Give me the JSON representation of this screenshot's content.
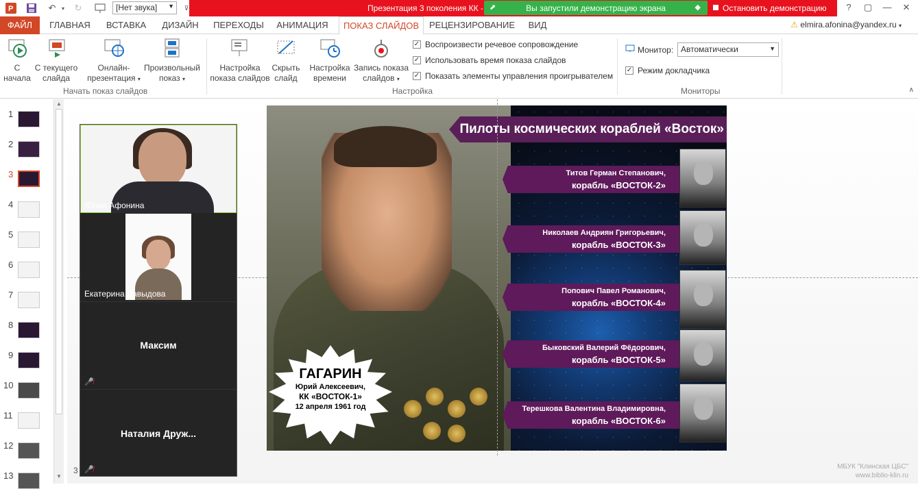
{
  "titlebar": {
    "sound_select": "[Нет звука]",
    "presentation_title": "Презентация 3 поколения КК -",
    "share_status": "Вы запустили демонстрацию экрана",
    "stop_share": "Остановить демонстрацию",
    "help": "?",
    "restore": "▢",
    "minimize": "—",
    "close": "✕"
  },
  "tabs": [
    {
      "label": "ФАЙЛ"
    },
    {
      "label": "ГЛАВНАЯ"
    },
    {
      "label": "ВСТАВКА"
    },
    {
      "label": "ДИЗАЙН"
    },
    {
      "label": "ПЕРЕХОДЫ"
    },
    {
      "label": "АНИМАЦИЯ"
    },
    {
      "label": "ПОКАЗ СЛАЙДОВ"
    },
    {
      "label": "РЕЦЕНЗИРОВАНИЕ"
    },
    {
      "label": "ВИД"
    }
  ],
  "user": {
    "email": "elmira.afonina@yandex.ru"
  },
  "ribbon": {
    "start": {
      "from_begin_l1": "С",
      "from_begin_l2": "начала",
      "from_current_l1": "С текущего",
      "from_current_l2": "слайда",
      "online_l1": "Онлайн-",
      "online_l2": "презентация",
      "custom_l1": "Произвольный",
      "custom_l2": "показ",
      "group": "Начать показ слайдов"
    },
    "setup": {
      "setup_l1": "Настройка",
      "setup_l2": "показа слайдов",
      "hide_l1": "Скрыть",
      "hide_l2": "слайд",
      "timing_l1": "Настройка",
      "timing_l2": "времени",
      "record_l1": "Запись показа",
      "record_l2": "слайдов",
      "chk1": "Воспроизвести речевое сопровождение",
      "chk2": "Использовать время показа слайдов",
      "chk3": "Показать элементы управления проигрывателем",
      "group": "Настройка"
    },
    "monitors": {
      "monitor_label": "Монитор:",
      "monitor_value": "Автоматически",
      "presenter": "Режим докладчика",
      "group": "Мониторы"
    }
  },
  "thumbnails": [
    "1",
    "2",
    "3",
    "4",
    "5",
    "6",
    "7",
    "8",
    "9",
    "10",
    "11",
    "12",
    "13"
  ],
  "video_panel": {
    "p1": "Юлия Афонина",
    "p2": "Екатерина Давыдова",
    "p3": "Максим",
    "p4": "Наталия  Друж..."
  },
  "slide": {
    "title": "Пилоты космических кораблей «Восток»",
    "pilots": [
      {
        "name": "Титов Герман Степанович,",
        "ship": "корабль «ВОСТОК-2»"
      },
      {
        "name": "Николаев Андриян Григорьевич,",
        "ship": "корабль «ВОСТОК-3»"
      },
      {
        "name": "Попович Павел Романович,",
        "ship": "корабль «ВОСТОК-4»"
      },
      {
        "name": "Быковский Валерий Фёдорович,",
        "ship": "корабль «ВОСТОК-5»"
      },
      {
        "name": "Терешкова Валентина Владимировна,",
        "ship": "корабль «ВОСТОК-6»"
      }
    ],
    "gagarin": {
      "surname": "ГАГАРИН",
      "name": "Юрий Алексеевич,",
      "ship": "КК «ВОСТОК-1»",
      "date": "12 апреля 1961 год"
    }
  },
  "footer": {
    "line1": "МБУК \"Клинская ЦБС\"",
    "line2": "www.biblio-klin.ru",
    "slide_counter": "3"
  }
}
